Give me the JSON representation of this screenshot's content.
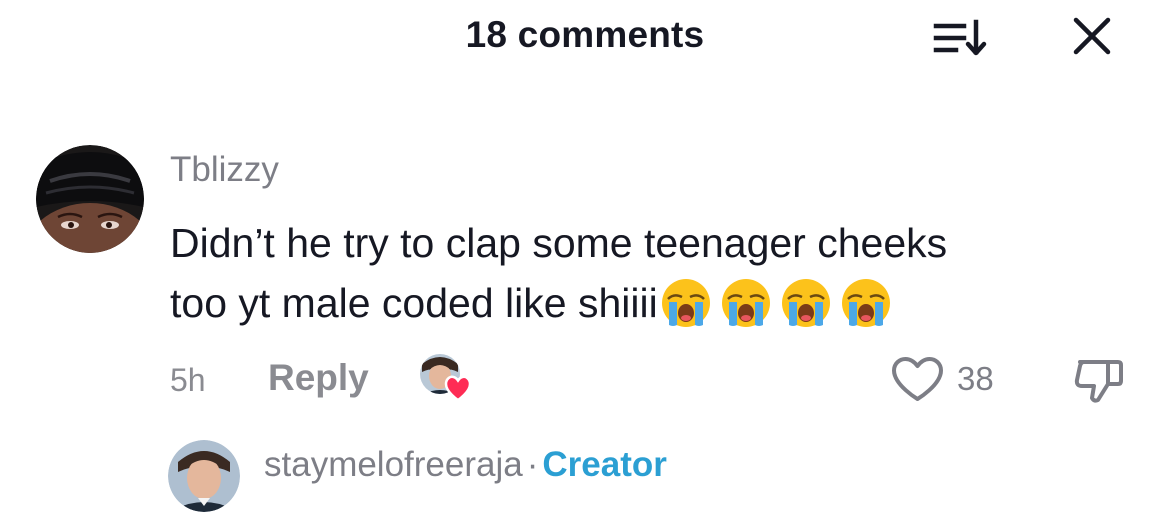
{
  "header": {
    "title": "18 comments",
    "sort_icon": "sort-descending-icon",
    "close_icon": "close-icon"
  },
  "comment": {
    "username": "Tblizzy",
    "line1": "Didn’t he try to clap some teenager cheeks",
    "line2": "too yt male coded like shiiii",
    "emojis": [
      "loudly-crying-face",
      "loudly-crying-face",
      "loudly-crying-face",
      "loudly-crying-face"
    ],
    "timestamp": "5h",
    "reply_label": "Reply",
    "like_count": "38",
    "creator_liked": true
  },
  "reply": {
    "username": "staymelofreeraja",
    "separator": "·",
    "badge": "Creator"
  },
  "colors": {
    "text_primary": "#161823",
    "text_secondary": "#7d7e86",
    "creator_blue": "#2b9fd3",
    "heart_red": "#fe2c55"
  }
}
